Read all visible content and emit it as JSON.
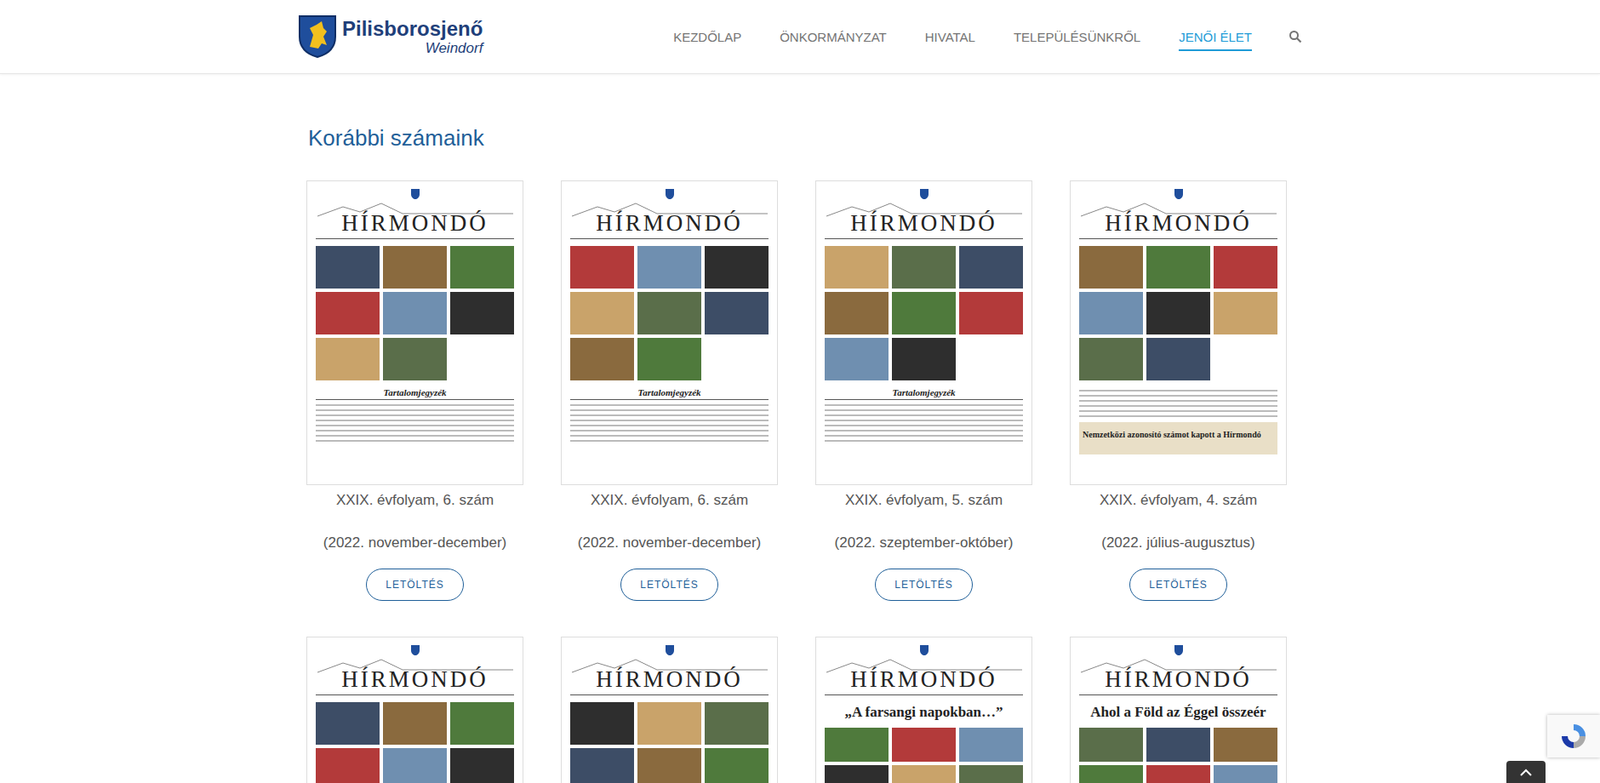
{
  "header": {
    "logo": {
      "name": "Pilisborosjenő",
      "subtitle": "Weindorf"
    },
    "nav": [
      {
        "label": "KEZDŐLAP",
        "selected": false
      },
      {
        "label": "ÖNKORMÁNYZAT",
        "selected": false
      },
      {
        "label": "HIVATAL",
        "selected": false
      },
      {
        "label": "TELEPÜLÉSÜNKRŐL",
        "selected": false
      },
      {
        "label": "JENŐI ÉLET",
        "selected": true
      }
    ]
  },
  "section_title": "Korábbi számaink",
  "issues": [
    {
      "kind": "toc",
      "masthead": "HÍRMONDÓ",
      "cover_label": "Tartalomjegyzék",
      "volume": "XXIX. évfolyam, 6. szám",
      "period": "(2022. november-december)",
      "button": "LETÖLTÉS"
    },
    {
      "kind": "toc",
      "masthead": "HÍRMONDÓ",
      "cover_label": "Tartalomjegyzék",
      "volume": "XXIX. évfolyam, 6. szám",
      "period": "(2022. november-december)",
      "button": "LETÖLTÉS"
    },
    {
      "kind": "toc",
      "masthead": "HÍRMONDÓ",
      "cover_label": "Tartalomjegyzék",
      "volume": "XXIX. évfolyam, 5. szám",
      "period": "(2022. szeptember-október)",
      "button": "LETÖLTÉS"
    },
    {
      "kind": "banner",
      "masthead": "HÍRMONDÓ",
      "cover_label": "Nemzetközi azonosító számot kapott a Hírmondó",
      "volume": "XXIX. évfolyam, 4. szám",
      "period": "(2022. július-augusztus)",
      "button": "LETÖLTÉS"
    }
  ],
  "more_issues": [
    {
      "kind": "photos",
      "masthead": "HÍRMONDÓ",
      "headline": ""
    },
    {
      "kind": "photos",
      "masthead": "HÍRMONDÓ",
      "headline": ""
    },
    {
      "kind": "headline",
      "masthead": "HÍRMONDÓ",
      "headline": "„A farsangi napokban…”"
    },
    {
      "kind": "headline",
      "masthead": "HÍRMONDÓ",
      "headline": "Ahol a Föld az Éggel összeér"
    }
  ]
}
